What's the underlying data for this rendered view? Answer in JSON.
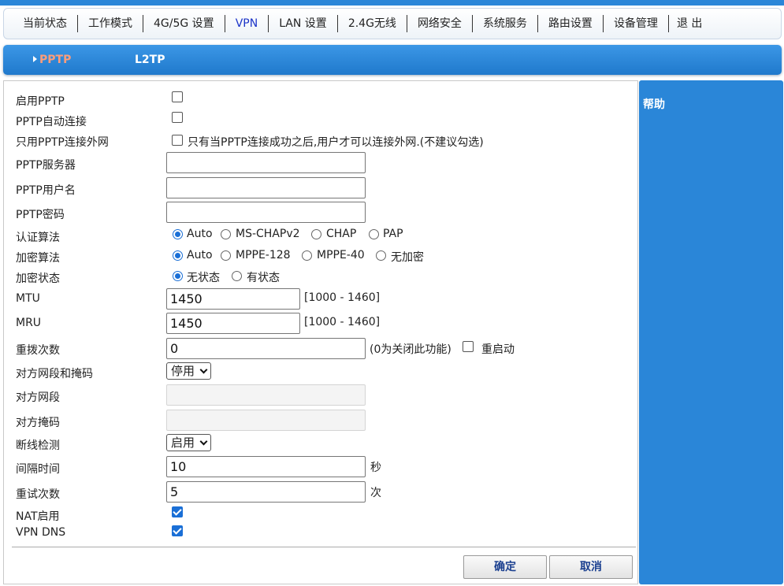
{
  "nav": {
    "items": [
      "当前状态",
      "工作模式",
      "4G/5G 设置",
      "VPN",
      "LAN 设置",
      "2.4G无线",
      "网络安全",
      "系统服务",
      "路由设置",
      "设备管理",
      "退 出"
    ],
    "active": "VPN"
  },
  "subtabs": {
    "pptp": "PPTP",
    "l2tp": "L2TP",
    "active": "PPTP"
  },
  "form": {
    "enable_pptp": {
      "label": "启用PPTP",
      "checked": false
    },
    "auto_connect": {
      "label": "PPTP自动连接",
      "checked": false
    },
    "pptp_only": {
      "label": "只用PPTP连接外网",
      "checked": false,
      "note": "只有当PPTP连接成功之后,用户才可以连接外网.(不建议勾选)"
    },
    "server": {
      "label": "PPTP服务器",
      "value": ""
    },
    "username": {
      "label": "PPTP用户名",
      "value": ""
    },
    "password": {
      "label": "PPTP密码",
      "value": ""
    },
    "auth": {
      "label": "认证算法",
      "options": [
        "Auto",
        "MS-CHAPv2",
        "CHAP",
        "PAP"
      ],
      "selected": "Auto"
    },
    "encryption": {
      "label": "加密算法",
      "options": [
        "Auto",
        "MPPE-128",
        "MPPE-40",
        "无加密"
      ],
      "selected": "Auto"
    },
    "enc_state": {
      "label": "加密状态",
      "options": [
        "无状态",
        "有状态"
      ],
      "selected": "无状态"
    },
    "mtu": {
      "label": "MTU",
      "value": "1450",
      "range": "[1000 - 1460]"
    },
    "mru": {
      "label": "MRU",
      "value": "1450",
      "range": "[1000 - 1460]"
    },
    "redial": {
      "label": "重拨次数",
      "value": "0",
      "note": "(0为关闭此功能)",
      "restart_label": "重启动",
      "restart_checked": false
    },
    "peer_subnet_mask": {
      "label": "对方网段和掩码",
      "selected": "停用"
    },
    "peer_subnet": {
      "label": "对方网段",
      "value": ""
    },
    "peer_mask": {
      "label": "对方掩码",
      "value": ""
    },
    "link_detect": {
      "label": "断线检测",
      "selected": "启用"
    },
    "interval": {
      "label": "间隔时间",
      "value": "10",
      "unit": "秒"
    },
    "retries": {
      "label": "重试次数",
      "value": "5",
      "unit": "次"
    },
    "nat": {
      "label": "NAT启用",
      "checked": true
    },
    "vpn_dns": {
      "label": "VPN DNS",
      "checked": true
    },
    "ok_label": "确定",
    "cancel_label": "取消"
  },
  "help": {
    "title": "帮助"
  },
  "colors": {
    "accent": "#2a86d8",
    "active_tab": "#ff9d7a",
    "active_nav": "#1c34c8"
  }
}
